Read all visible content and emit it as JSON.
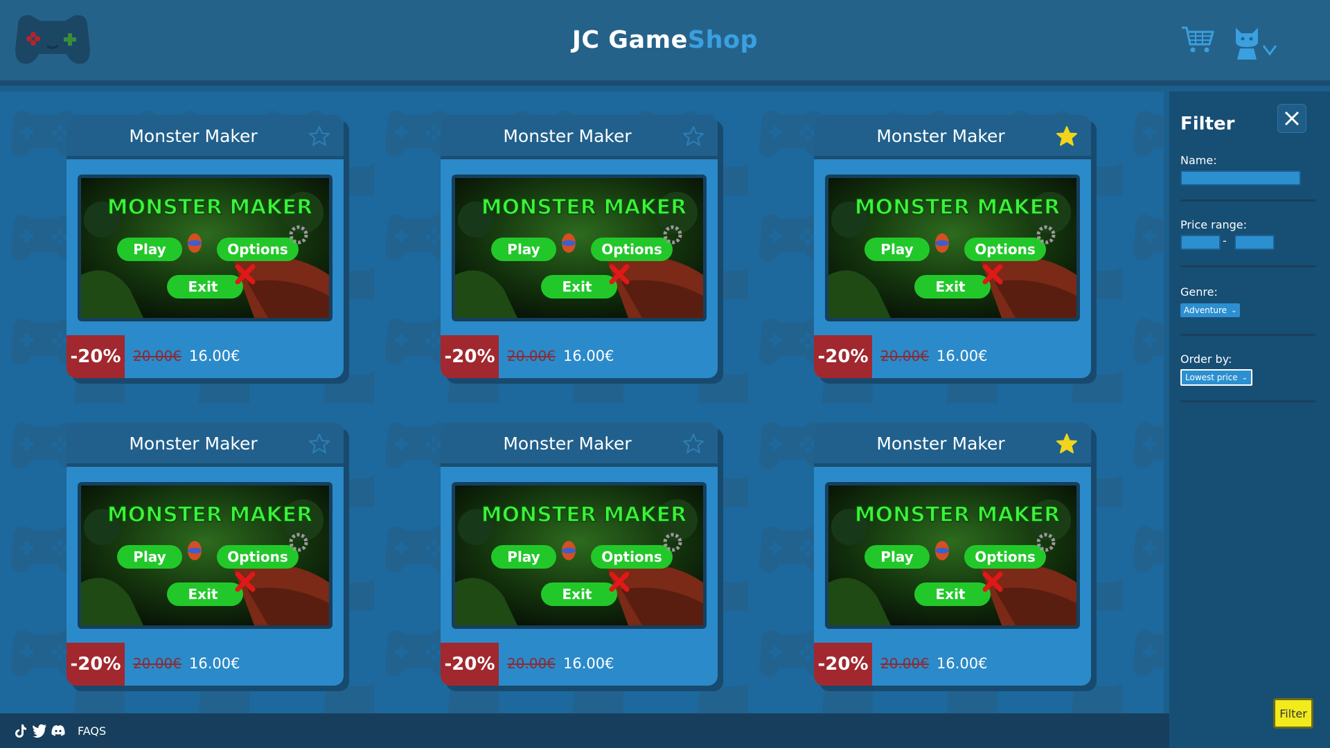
{
  "header": {
    "title_part1": "JC Game",
    "title_part2": "Shop",
    "icons": [
      "gamepad-logo",
      "shopping-cart",
      "user-cat-avatar",
      "chevron-down"
    ]
  },
  "colors": {
    "accent": "#3aa0e0",
    "discount": "#a1282f",
    "star_active": "#f2d41a",
    "filter_button": "#f1ea1c"
  },
  "products": [
    {
      "title": "Monster Maker",
      "discount": "-20%",
      "old_price": "20.00€",
      "price": "16.00€",
      "favorite": false,
      "thumbnail": {
        "logo": "MONSTER MAKER",
        "play": "Play",
        "options": "Options",
        "exit": "Exit"
      }
    },
    {
      "title": "Monster Maker",
      "discount": "-20%",
      "old_price": "20.00€",
      "price": "16.00€",
      "favorite": false,
      "thumbnail": {
        "logo": "MONSTER MAKER",
        "play": "Play",
        "options": "Options",
        "exit": "Exit"
      }
    },
    {
      "title": "Monster Maker",
      "discount": "-20%",
      "old_price": "20.00€",
      "price": "16.00€",
      "favorite": true,
      "thumbnail": {
        "logo": "MONSTER MAKER",
        "play": "Play",
        "options": "Options",
        "exit": "Exit"
      }
    },
    {
      "title": "Monster Maker",
      "discount": "-20%",
      "old_price": "20.00€",
      "price": "16.00€",
      "favorite": false,
      "thumbnail": {
        "logo": "MONSTER MAKER",
        "play": "Play",
        "options": "Options",
        "exit": "Exit"
      }
    },
    {
      "title": "Monster Maker",
      "discount": "-20%",
      "old_price": "20.00€",
      "price": "16.00€",
      "favorite": false,
      "thumbnail": {
        "logo": "MONSTER MAKER",
        "play": "Play",
        "options": "Options",
        "exit": "Exit"
      }
    },
    {
      "title": "Monster Maker",
      "discount": "-20%",
      "old_price": "20.00€",
      "price": "16.00€",
      "favorite": true,
      "thumbnail": {
        "logo": "MONSTER MAKER",
        "play": "Play",
        "options": "Options",
        "exit": "Exit"
      }
    }
  ],
  "filter": {
    "title": "Filter",
    "name_label": "Name:",
    "name_value": "",
    "price_label": "Price range:",
    "price_min": "",
    "price_max": "",
    "price_separator": "-",
    "genre_label": "Genre:",
    "genre_selected": "Adventure",
    "order_label": "Order by:",
    "order_selected": "Lowest price",
    "button_label": "Filter"
  },
  "footer": {
    "icons": [
      "tiktok-icon",
      "twitter-icon",
      "discord-icon"
    ],
    "faqs": "FAQS"
  }
}
